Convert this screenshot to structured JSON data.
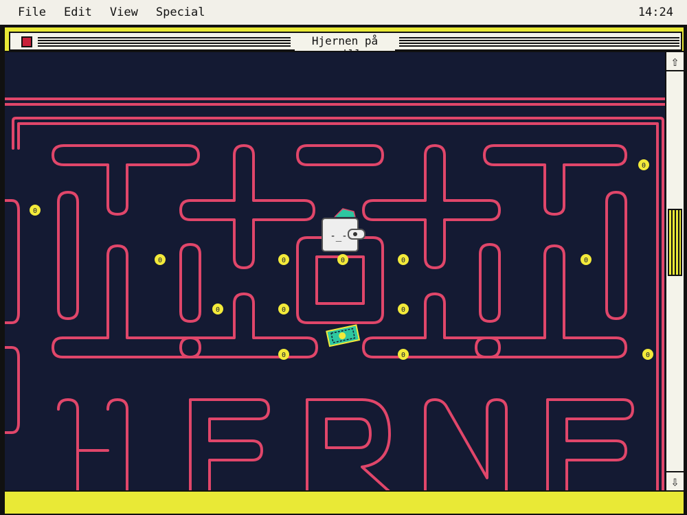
{
  "menubar": {
    "items": [
      "File",
      "Edit",
      "View",
      "Special"
    ],
    "clock": "14:24"
  },
  "window": {
    "title": "Hjernen på spill"
  },
  "scrollbar": {
    "up_icon": "arrow-up-icon",
    "down_icon": "arrow-down-icon"
  },
  "game": {
    "coin_symbol": "0",
    "player_face": "-_-",
    "pickup_icon": "ticket-icon",
    "colors": {
      "background": "#141a33",
      "maze": "#e0466a",
      "coin": "#f3ea3a",
      "player": "#eeeeee",
      "pickup": "#2ec7a0"
    }
  }
}
